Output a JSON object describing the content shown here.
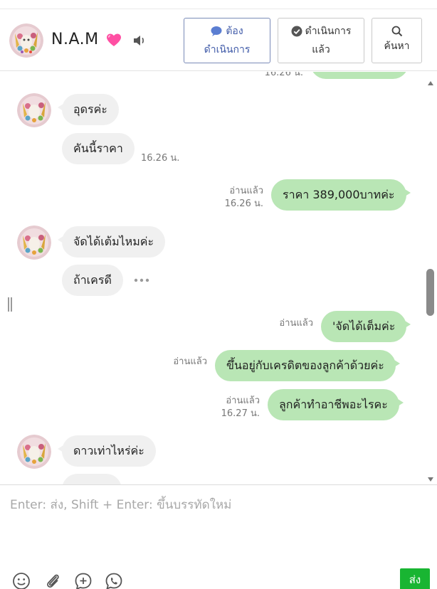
{
  "header": {
    "contact_name": "N.A.M",
    "buttons": [
      {
        "line1": "ต้อง",
        "line2": "ดำเนินการ",
        "icon": "speech-bubble-icon"
      },
      {
        "line1": "ดำเนินการ",
        "line2": "แล้ว",
        "icon": "check-circle-icon"
      },
      {
        "line1": "",
        "line2": "ค้นหา",
        "icon": "search-icon"
      }
    ],
    "accent_color": "#3f5aa8"
  },
  "chat": {
    "top_partial": {
      "time": "16.26 น."
    },
    "messages": [
      {
        "text": "อุดรค่ะ",
        "direction": "in"
      },
      {
        "text": "คันนี้ราคา",
        "direction": "in",
        "time": "16.26 น."
      },
      {
        "text": "ราคา 389,000บาทค่ะ",
        "direction": "out",
        "read": "อ่านแล้ว",
        "time": "16.26 น."
      },
      {
        "text": "จัดได้เต้มไหมค่ะ",
        "direction": "in"
      },
      {
        "text": "ถ้าเครดี",
        "direction": "in"
      },
      {
        "text": "'จัดได้เต็มค่ะ",
        "direction": "out",
        "read": "อ่านแล้ว"
      },
      {
        "text": "ขึ้นอยู่กับเครดิตของลูกค้าด้วยค่ะ",
        "direction": "out",
        "read": "อ่านแล้ว"
      },
      {
        "text": "ลูกค้าทำอาชีพอะไรคะ",
        "direction": "out",
        "read": "อ่านแล้ว",
        "time": "16.27 น."
      },
      {
        "text": "ดาวเท่าไหร่ค่ะ",
        "direction": "in"
      }
    ],
    "incoming_color": "#f0f0f0",
    "outgoing_color": "#b9e6b5"
  },
  "composer": {
    "placeholder": "Enter: ส่ง, Shift + Enter: ขึ้นบรรทัดใหม่",
    "value": "",
    "send_label": "ส่ง",
    "send_color": "#19b532",
    "tools": [
      "emoji-icon",
      "attachment-icon",
      "add-sticker-icon",
      "call-icon"
    ]
  }
}
